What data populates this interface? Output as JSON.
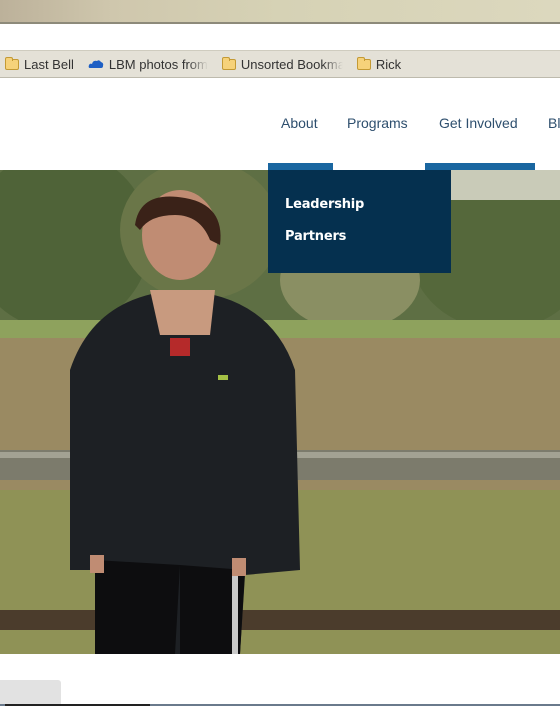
{
  "browser": {
    "bookmarks": [
      {
        "icon": "folder-icon",
        "label": "Last Bell"
      },
      {
        "icon": "onedrive-cloud-icon",
        "label": "LBM photos from"
      },
      {
        "icon": "folder-icon",
        "label": "Unsorted Bookmarks"
      },
      {
        "icon": "folder-icon",
        "label": "Rick"
      }
    ]
  },
  "nav": {
    "items": [
      {
        "label": "About"
      },
      {
        "label": "Programs"
      },
      {
        "label": "Get Involved"
      },
      {
        "label": "Bl"
      }
    ],
    "accent_color": "#1a66a0"
  },
  "dropdown": {
    "background": "#05304f",
    "items": [
      {
        "label": "Leadership"
      },
      {
        "label": "Partners"
      }
    ]
  },
  "hero": {
    "image": "young-man-black-jacket-in-field-by-fence"
  }
}
